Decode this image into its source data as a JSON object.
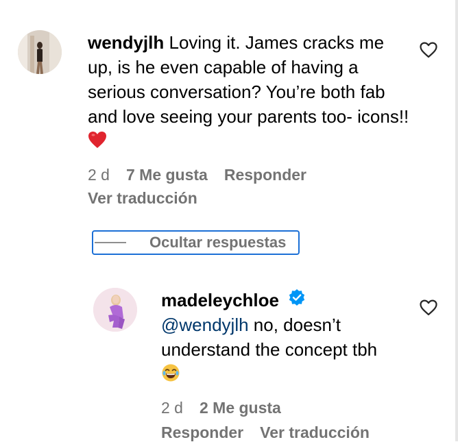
{
  "comment": {
    "username": "wendyjlh",
    "text": "Loving it. James cracks me up, is he even capable of having a serious conversation? You’re both fab and love seeing your parents too- icons!!",
    "emoji": "heart-emoji",
    "time": "2 d",
    "likes": "7 Me gusta",
    "reply_label": "Responder",
    "translate_label": "Ver traducción"
  },
  "replies_toggle": {
    "label": "Ocultar respuestas"
  },
  "reply": {
    "username": "madeleychloe",
    "verified": true,
    "mention": "@wendyjlh",
    "text": "no, doesn’t understand the concept tbh",
    "emoji": "laughing-emoji",
    "time": "2 d",
    "likes": "2 Me gusta",
    "reply_label": "Responder",
    "translate_label": "Ver traducción"
  },
  "colors": {
    "secondary_text": "#737373",
    "mention": "#00376b",
    "verified": "#0095f6",
    "focus_border": "#1b6fd6",
    "heart_emoji": "#e0242e"
  }
}
